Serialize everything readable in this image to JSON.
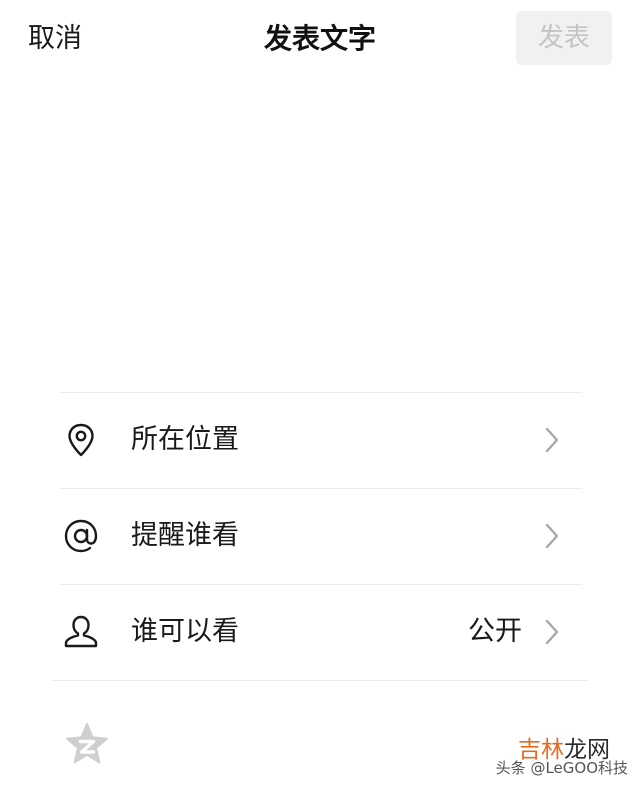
{
  "header": {
    "cancel_label": "取消",
    "title": "发表文字",
    "publish_label": "发表"
  },
  "compose": {
    "placeholder": ""
  },
  "options": [
    {
      "label": "所在位置",
      "icon": "location-pin-icon"
    },
    {
      "label": "提醒谁看",
      "icon": "at-icon"
    },
    {
      "label": "谁可以看",
      "icon": "person-icon",
      "value": "公开"
    }
  ],
  "footer": {
    "icon": "star-icon"
  },
  "watermark": {
    "main_accent": "吉林",
    "main_rest": "龙网",
    "sub": "头条 @LeGOO科技"
  },
  "colors": {
    "publish_bg": "#f1f1f1",
    "publish_text": "#c4c4c4",
    "divider": "#ececec",
    "watermark_accent": "#e8691e"
  }
}
